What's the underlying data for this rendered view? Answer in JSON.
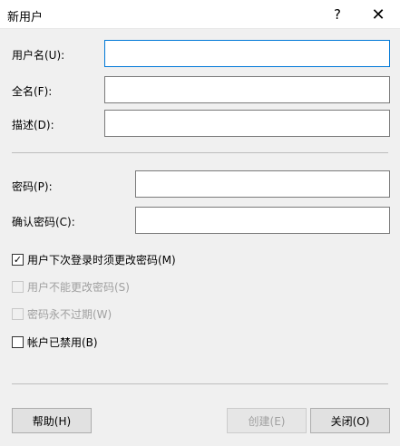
{
  "window": {
    "title": "新用户",
    "help_glyph": "?",
    "close_glyph": "✕"
  },
  "fields": {
    "username_label": "用户名(U):",
    "username_value": "",
    "fullname_label": "全名(F):",
    "fullname_value": "",
    "description_label": "描述(D):",
    "description_value": "",
    "password_label": "密码(P):",
    "password_value": "",
    "confirm_label": "确认密码(C):",
    "confirm_value": ""
  },
  "options": {
    "must_change": {
      "label": "用户下次登录时须更改密码(M)",
      "checked": true
    },
    "cannot_change": {
      "label": "用户不能更改密码(S)",
      "checked": false,
      "disabled": true
    },
    "never_expires": {
      "label": "密码永不过期(W)",
      "checked": false,
      "disabled": true
    },
    "disabled_account": {
      "label": "帐户已禁用(B)",
      "checked": false
    }
  },
  "buttons": {
    "help": "帮助(H)",
    "create": "创建(E)",
    "close": "关闭(O)"
  },
  "colors": {
    "focus_border": "#0078d7",
    "dialog_bg": "#f0f0f0"
  }
}
